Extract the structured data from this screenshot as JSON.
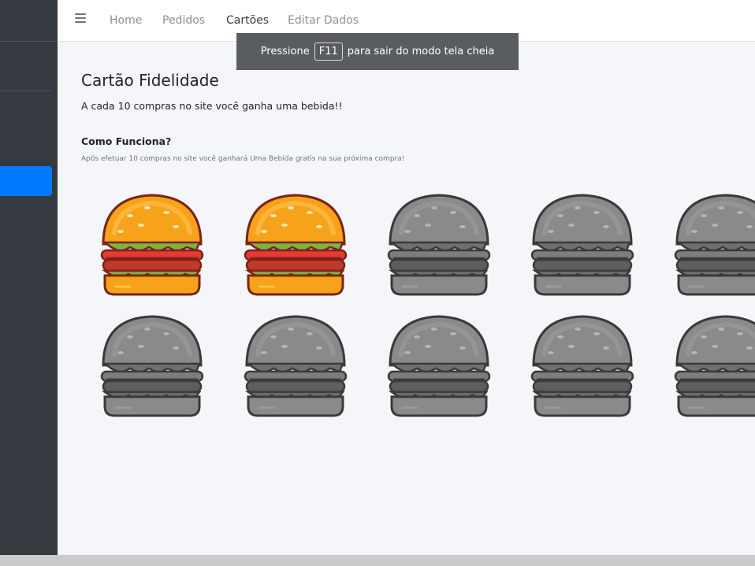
{
  "nav": {
    "menu_icon": "hamburger-menu-icon",
    "items": [
      {
        "label": "Home",
        "active": false
      },
      {
        "label": "Pedidos",
        "active": false
      },
      {
        "label": "Cartões",
        "active": true
      },
      {
        "label": "Editar Dados",
        "active": false
      }
    ]
  },
  "fullscreen_notice": {
    "before": "Pressione",
    "key": "F11",
    "after": "para sair do modo tela cheia"
  },
  "page": {
    "title": "Cartão Fidelidade",
    "subtitle": "A cada 10 compras no site você ganha uma bebida!!",
    "how_title": "Como Funciona?",
    "how_text": "Após efetuar 10 compras no site você ganhará Uma Bebida gratis na sua próxima compra!"
  },
  "loyalty": {
    "total_stamps": 10,
    "earned_stamps": 2,
    "stamp_icon": "hamburger-icon"
  },
  "colors": {
    "sidebar": "#343a40",
    "active_accent": "#007bff",
    "background": "#f4f6f9"
  }
}
